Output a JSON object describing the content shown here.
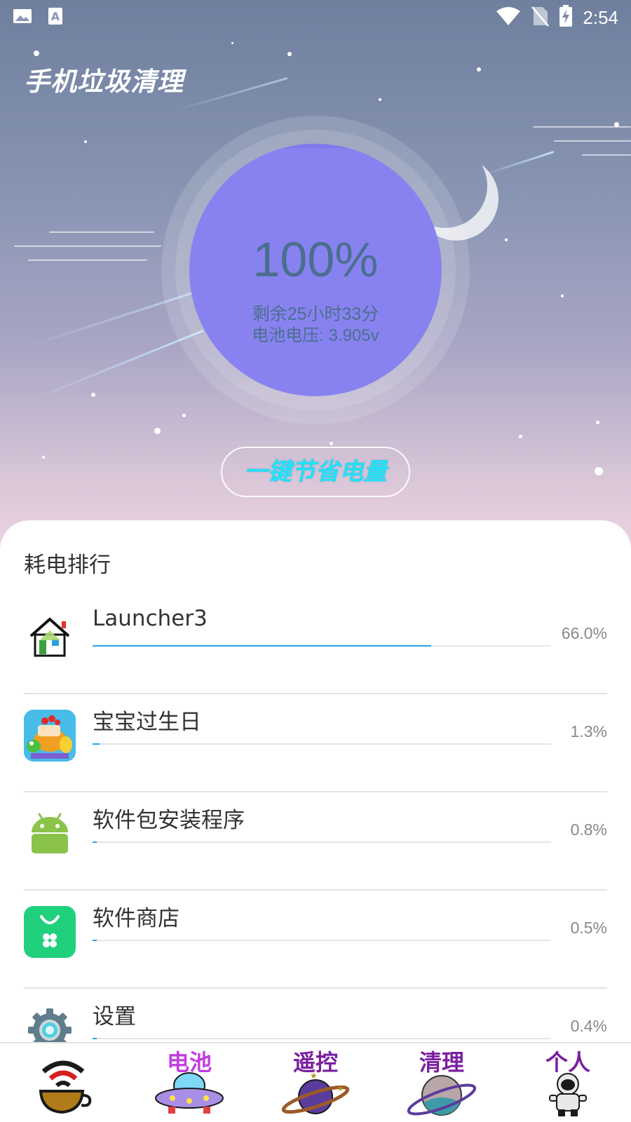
{
  "status_bar": {
    "time": "2:54",
    "left_icons": [
      "image-icon",
      "font-a-icon"
    ],
    "right_icons": [
      "wifi-icon",
      "no-sim-icon",
      "battery-charging-icon"
    ]
  },
  "header": {
    "title": "手机垃圾清理"
  },
  "battery": {
    "percent": "100%",
    "remaining": "剩余25小时33分",
    "voltage": "电池电压: 3.905v"
  },
  "actions": {
    "save_power": "一键节省电量"
  },
  "ranking": {
    "title": "耗电排行",
    "items": [
      {
        "name": "Launcher3",
        "percent": "66.0%",
        "value": 0.66,
        "icon": "house-icon"
      },
      {
        "name": "宝宝过生日",
        "percent": "1.3%",
        "value": 0.013,
        "icon": "birthday-game-icon"
      },
      {
        "name": "软件包安装程序",
        "percent": "0.8%",
        "value": 0.008,
        "icon": "android-icon"
      },
      {
        "name": "软件商店",
        "percent": "0.5%",
        "value": 0.005,
        "icon": "app-store-icon"
      },
      {
        "name": "设置",
        "percent": "0.4%",
        "value": 0.004,
        "icon": "settings-gear-icon"
      }
    ]
  },
  "bottom_nav": {
    "items": [
      {
        "label": "",
        "icon": "wifi-cup-icon"
      },
      {
        "label": "电池",
        "icon": "ufo-icon"
      },
      {
        "label": "遥控",
        "icon": "planet-icon"
      },
      {
        "label": "清理",
        "icon": "ringed-planet-icon"
      },
      {
        "label": "个人",
        "icon": "astronaut-icon"
      }
    ]
  },
  "colors": {
    "circle": "#8882f0",
    "accent_text": "#4a6f8e",
    "button_text": "#22e0f5",
    "bar": "#25a6e8",
    "nav_label": "#7a1fa0"
  }
}
